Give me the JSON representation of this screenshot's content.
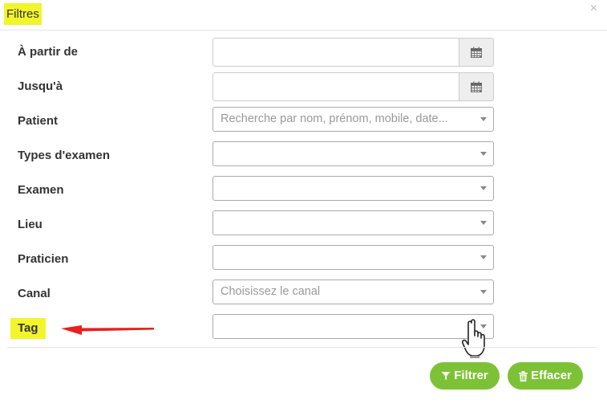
{
  "dialog": {
    "title": "Filtres",
    "close_icon": "×"
  },
  "fields": [
    {
      "label": "À partir de",
      "type": "date",
      "value": "",
      "icon": "calendar-icon"
    },
    {
      "label": "Jusqu'à",
      "type": "date",
      "value": "",
      "icon": "calendar-icon"
    },
    {
      "label": "Patient",
      "type": "select",
      "placeholder": "Recherche par nom, prénom, mobile, date..."
    },
    {
      "label": "Types d'examen",
      "type": "select",
      "placeholder": ""
    },
    {
      "label": "Examen",
      "type": "select",
      "placeholder": ""
    },
    {
      "label": "Lieu",
      "type": "select",
      "placeholder": ""
    },
    {
      "label": "Praticien",
      "type": "select",
      "placeholder": ""
    },
    {
      "label": "Canal",
      "type": "select",
      "placeholder": "Choisissez le canal"
    },
    {
      "label": "Tag",
      "type": "select",
      "placeholder": "",
      "highlighted": true
    }
  ],
  "buttons": {
    "filter": {
      "label": "Filtrer",
      "icon": "filter-icon"
    },
    "clear": {
      "label": "Effacer",
      "icon": "trash-icon"
    }
  },
  "colors": {
    "highlight": "#f2f52a",
    "button_green": "#7dc236",
    "annotation_arrow": "#e8201e"
  }
}
